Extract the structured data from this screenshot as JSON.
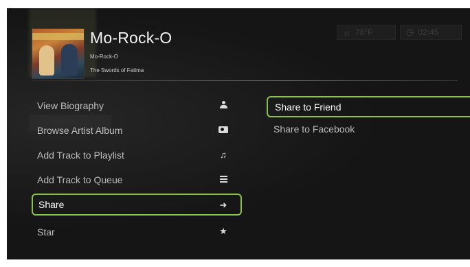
{
  "header": {
    "track_title": "Mo-Rock-O",
    "artist": "Mo-Rock-O",
    "album": "The Swords of Fatima",
    "album_art_icon": "album-cover"
  },
  "status": {
    "weather": "78°F",
    "weather_icon": "sun-icon",
    "clock": "02:45",
    "clock_icon": "clock-icon"
  },
  "menu": {
    "items": [
      {
        "label": "View Biography",
        "icon": "person-icon"
      },
      {
        "label": "Browse Artist Album",
        "icon": "album-icon"
      },
      {
        "label": "Add Track to Playlist",
        "icon": "music-note-icon"
      },
      {
        "label": "Add Track to Queue",
        "icon": "queue-icon"
      },
      {
        "label": "Share",
        "icon": "arrow-right-icon",
        "selected": true
      },
      {
        "label": "Star",
        "icon": "star-icon"
      }
    ]
  },
  "submenu": {
    "items": [
      {
        "label": "Share to Friend",
        "selected": true
      },
      {
        "label": "Share to Facebook"
      }
    ]
  },
  "colors": {
    "background": "#151515",
    "accent": "#8bc34a",
    "text": "#bdbdbd"
  }
}
